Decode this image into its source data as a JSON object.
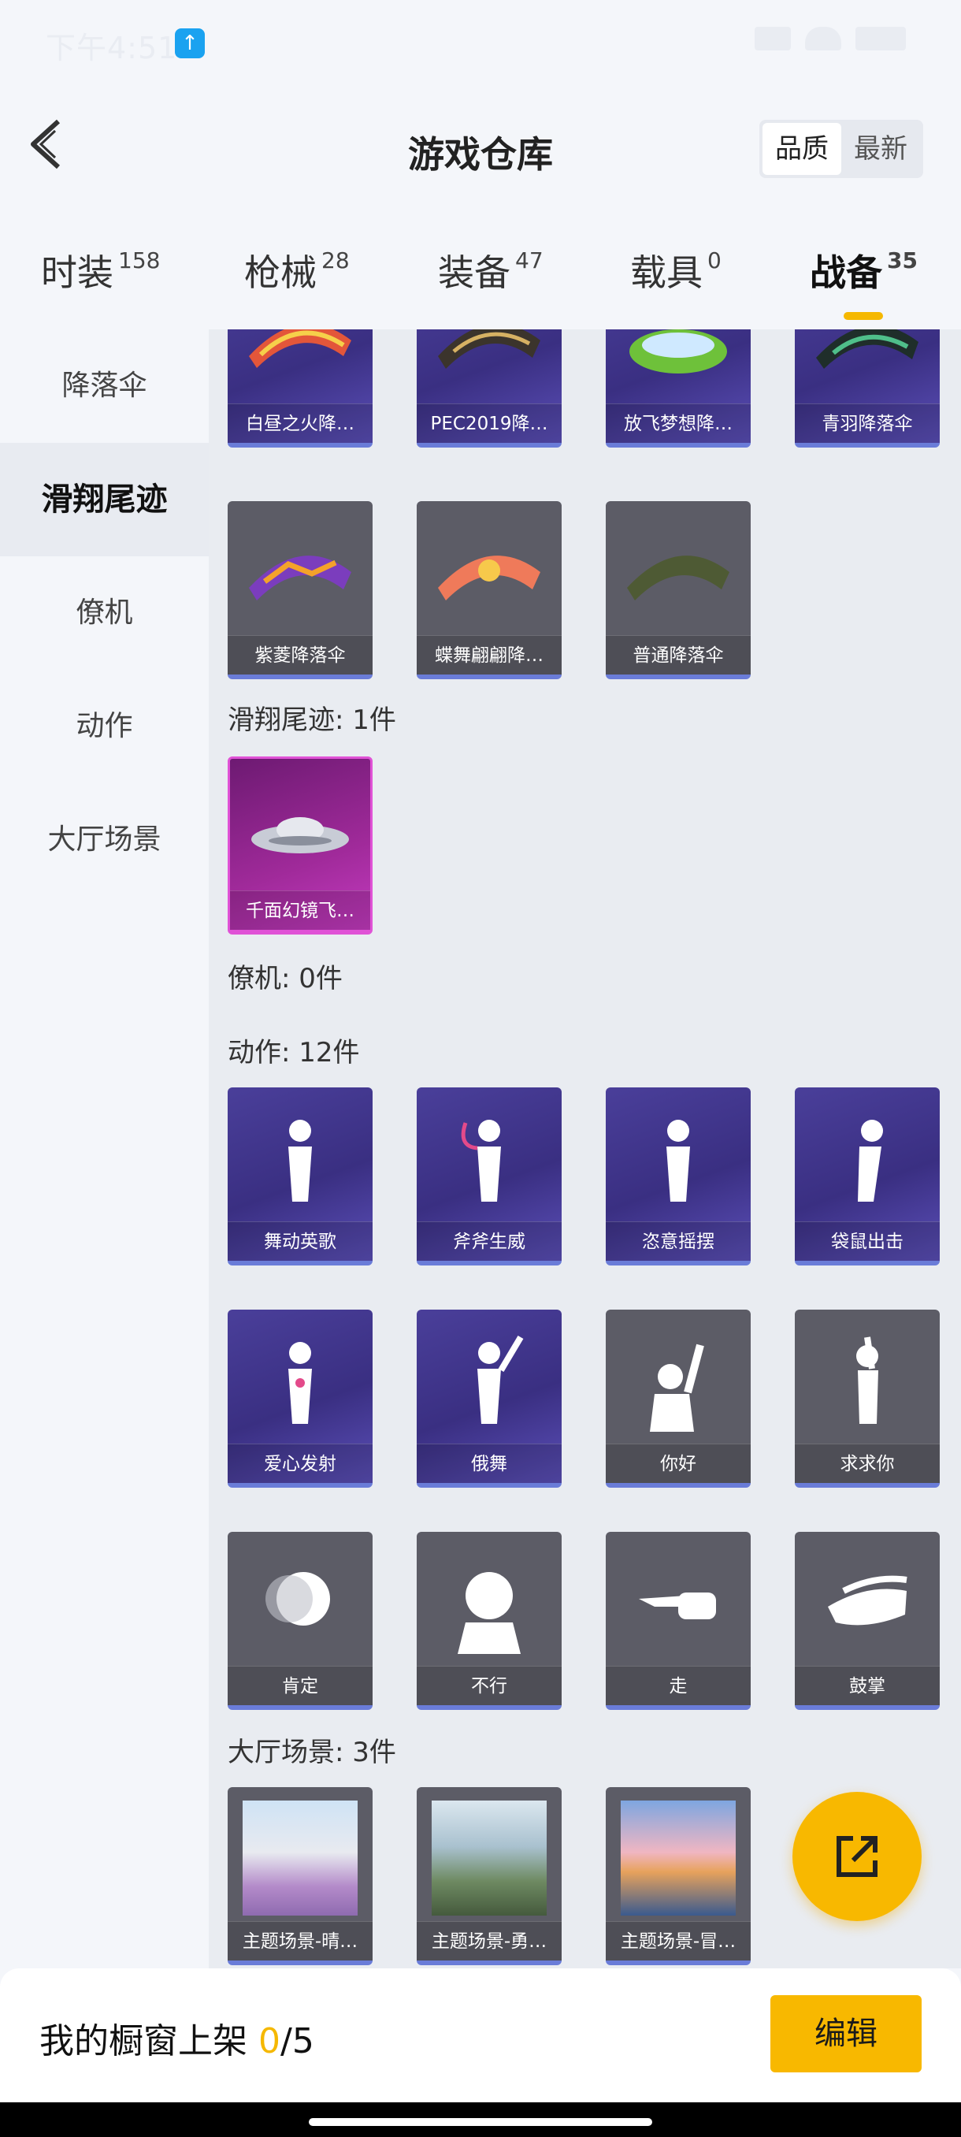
{
  "status": {
    "time": "下午4:51",
    "upload_icon": "arrow-up-icon"
  },
  "header": {
    "title": "游戏仓库",
    "sort_options": [
      "品质",
      "最新"
    ],
    "active_sort": "品质"
  },
  "tabs": [
    {
      "label": "时装",
      "count": "158"
    },
    {
      "label": "枪械",
      "count": "28"
    },
    {
      "label": "装备",
      "count": "47"
    },
    {
      "label": "载具",
      "count": "0"
    },
    {
      "label": "战备",
      "count": "35",
      "active": true
    }
  ],
  "sidebar": {
    "items": [
      "降落伞",
      "滑翔尾迹",
      "僚机",
      "动作",
      "大厅场景"
    ],
    "active": "滑翔尾迹"
  },
  "sections": {
    "parachutes_top": [
      "白昼之火降…",
      "PEC2019降…",
      "放飞梦想降…",
      "青羽降落伞"
    ],
    "parachutes_row2": [
      "紫菱降落伞",
      "蝶舞翩翩降…",
      "普通降落伞"
    ],
    "glide_title": "滑翔尾迹: 1件",
    "glide_items": [
      "千面幻镜飞…"
    ],
    "wingman_title": "僚机: 0件",
    "emote_title": "动作: 12件",
    "emotes": [
      "舞动英歌",
      "斧斧生威",
      "恣意摇摆",
      "袋鼠出击",
      "爱心发射",
      "俄舞",
      "你好",
      "求求你",
      "肯定",
      "不行",
      "走",
      "鼓掌"
    ],
    "lobby_title": "大厅场景: 3件",
    "lobby_items": [
      "主题场景-晴…",
      "主题场景-勇…",
      "主题场景-冒…"
    ]
  },
  "bottom": {
    "label": "我的橱窗上架 ",
    "current": "0",
    "total": "/5",
    "edit_label": "编辑"
  },
  "colors": {
    "accent": "#f8b800",
    "purple_card": "#3a2f82",
    "gray_card": "#5c5c66"
  }
}
